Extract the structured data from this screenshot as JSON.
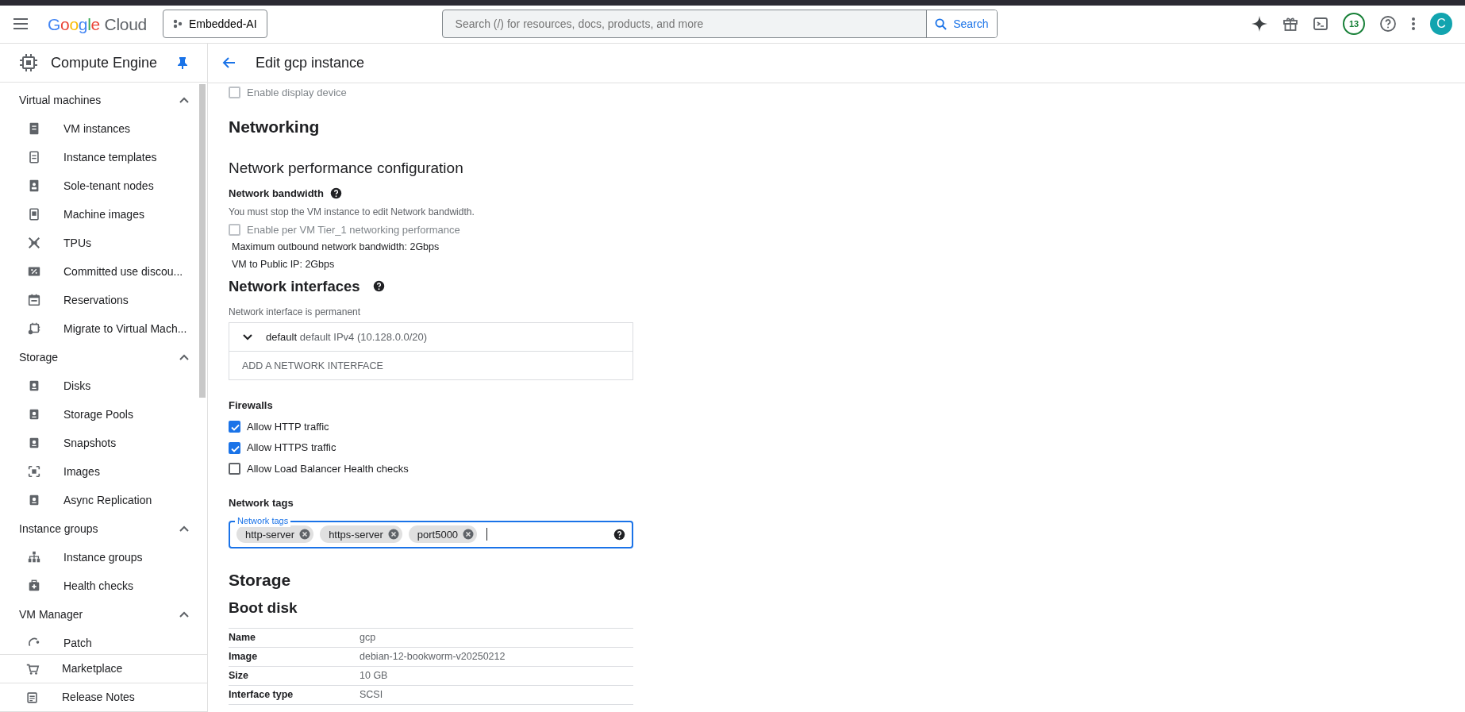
{
  "topbar": {
    "brand": "Google Cloud",
    "project": "Embedded-AI",
    "search_placeholder": "Search (/) for resources, docs, products, and more",
    "search_button": "Search",
    "notification_count": "13",
    "avatar": "C"
  },
  "product": {
    "title": "Compute Engine",
    "pinned": true
  },
  "page": {
    "title": "Edit gcp instance"
  },
  "sidebar": {
    "sections": [
      {
        "title": "Virtual machines",
        "expanded": true,
        "items": [
          {
            "label": "VM instances"
          },
          {
            "label": "Instance templates"
          },
          {
            "label": "Sole-tenant nodes"
          },
          {
            "label": "Machine images"
          },
          {
            "label": "TPUs"
          },
          {
            "label": "Committed use discou..."
          },
          {
            "label": "Reservations"
          },
          {
            "label": "Migrate to Virtual Mach..."
          }
        ]
      },
      {
        "title": "Storage",
        "expanded": true,
        "items": [
          {
            "label": "Disks"
          },
          {
            "label": "Storage Pools"
          },
          {
            "label": "Snapshots"
          },
          {
            "label": "Images"
          },
          {
            "label": "Async Replication"
          }
        ]
      },
      {
        "title": "Instance groups",
        "expanded": true,
        "items": [
          {
            "label": "Instance groups"
          },
          {
            "label": "Health checks"
          }
        ]
      },
      {
        "title": "VM Manager",
        "expanded": true,
        "items": [
          {
            "label": "Patch"
          }
        ]
      }
    ],
    "footer_items": [
      {
        "label": "Marketplace"
      },
      {
        "label": "Release Notes"
      }
    ]
  },
  "content": {
    "display_device": {
      "label": "Enable display device",
      "checked": false,
      "disabled": true
    },
    "networking_heading": "Networking",
    "performance_heading": "Network performance configuration",
    "bandwidth_label": "Network bandwidth",
    "bandwidth_hint": "You must stop the VM instance to edit Network bandwidth.",
    "tier1": {
      "label": "Enable per VM Tier_1 networking performance",
      "checked": false,
      "disabled": true
    },
    "bandwidth_lines": [
      "Maximum outbound network bandwidth: 2Gbps",
      "VM to Public IP: 2Gbps"
    ],
    "interfaces_heading": "Network interfaces",
    "interfaces_hint": "Network interface is permanent",
    "interface": {
      "name": "default",
      "detail": "default IPv4 (10.128.0.0/20)",
      "expanded": false
    },
    "add_interface": "ADD A NETWORK INTERFACE",
    "firewalls_label": "Firewalls",
    "firewalls": [
      {
        "label": "Allow HTTP traffic",
        "checked": true
      },
      {
        "label": "Allow HTTPS traffic",
        "checked": true
      },
      {
        "label": "Allow Load Balancer Health checks",
        "checked": false
      }
    ],
    "tags_label": "Network tags",
    "tags_field": {
      "label": "Network tags",
      "tags": [
        "http-server",
        "https-server",
        "port5000"
      ]
    },
    "storage_heading": "Storage",
    "boot_disk_heading": "Boot disk",
    "boot_disk": [
      {
        "label": "Name",
        "value": "gcp"
      },
      {
        "label": "Image",
        "value": "debian-12-bookworm-v20250212"
      },
      {
        "label": "Size",
        "value": "10 GB"
      },
      {
        "label": "Interface type",
        "value": "SCSI"
      }
    ]
  }
}
